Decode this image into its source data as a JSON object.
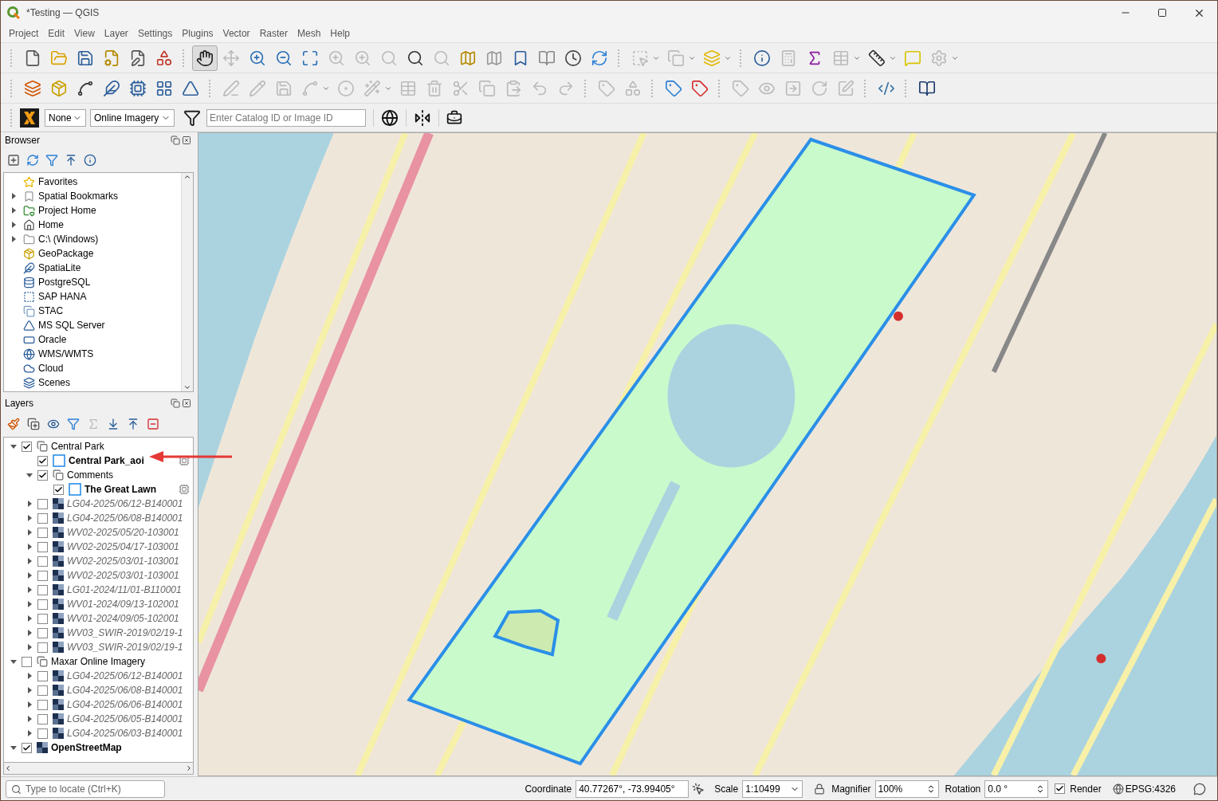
{
  "window": {
    "title": "*Testing — QGIS"
  },
  "menu": [
    "Project",
    "Edit",
    "View",
    "Layer",
    "Settings",
    "Plugins",
    "Vector",
    "Raster",
    "Mesh",
    "Help"
  ],
  "imagery_toolbar": {
    "dropdowns": [
      "None",
      "Online Imagery"
    ],
    "search": {
      "placeholder": "Enter Catalog ID or Image ID"
    }
  },
  "browser": {
    "title": "Browser",
    "items": [
      {
        "label": "Favorites"
      },
      {
        "label": "Spatial Bookmarks",
        "expanded": false
      },
      {
        "label": "Project Home",
        "expanded": false
      },
      {
        "label": "Home",
        "expanded": false
      },
      {
        "label": "C:\\ (Windows)",
        "expanded": false
      },
      {
        "label": "GeoPackage"
      },
      {
        "label": "SpatiaLite"
      },
      {
        "label": "PostgreSQL"
      },
      {
        "label": "SAP HANA"
      },
      {
        "label": "STAC"
      },
      {
        "label": "MS SQL Server"
      },
      {
        "label": "Oracle"
      },
      {
        "label": "WMS/WMTS"
      },
      {
        "label": "Cloud"
      },
      {
        "label": "Scenes"
      }
    ]
  },
  "layers": {
    "title": "Layers",
    "tree": [
      {
        "kind": "group",
        "label": "Central Park",
        "checked": true,
        "expanded": true,
        "children": [
          {
            "kind": "vector",
            "label": "Central Park_aoi",
            "checked": true
          },
          {
            "kind": "group",
            "label": "Comments",
            "checked": true,
            "expanded": true,
            "children": [
              {
                "kind": "vector",
                "label": "The Great Lawn",
                "checked": true
              }
            ]
          },
          {
            "kind": "raster",
            "label": "LG04-2025/06/12-B140001",
            "checked": false,
            "expanded": false
          },
          {
            "kind": "raster",
            "label": "LG04-2025/06/08-B140001",
            "checked": false,
            "expanded": false
          },
          {
            "kind": "raster",
            "label": "WV02-2025/05/20-103001",
            "checked": false,
            "expanded": false
          },
          {
            "kind": "raster",
            "label": "WV02-2025/04/17-103001",
            "checked": false,
            "expanded": false
          },
          {
            "kind": "raster",
            "label": "WV02-2025/03/01-103001",
            "checked": false,
            "expanded": false
          },
          {
            "kind": "raster",
            "label": "WV02-2025/03/01-103001",
            "checked": false,
            "expanded": false
          },
          {
            "kind": "raster",
            "label": "LG01-2024/11/01-B110001",
            "checked": false,
            "expanded": false
          },
          {
            "kind": "raster",
            "label": "WV01-2024/09/13-102001",
            "checked": false,
            "expanded": false
          },
          {
            "kind": "raster",
            "label": "WV01-2024/09/05-102001",
            "checked": false,
            "expanded": false
          },
          {
            "kind": "raster",
            "label": "WV03_SWIR-2019/02/19-1",
            "checked": false,
            "expanded": false
          },
          {
            "kind": "raster",
            "label": "WV03_SWIR-2019/02/19-1",
            "checked": false,
            "expanded": false
          }
        ]
      },
      {
        "kind": "group",
        "label": "Maxar Online Imagery",
        "checked": false,
        "expanded": true,
        "children": [
          {
            "kind": "raster",
            "label": "LG04-2025/06/12-B140001",
            "checked": false,
            "expanded": false
          },
          {
            "kind": "raster",
            "label": "LG04-2025/06/08-B140001",
            "checked": false,
            "expanded": false
          },
          {
            "kind": "raster",
            "label": "LG04-2025/06/06-B140001",
            "checked": false,
            "expanded": false
          },
          {
            "kind": "raster",
            "label": "LG04-2025/06/05-B140001",
            "checked": false,
            "expanded": false
          },
          {
            "kind": "raster",
            "label": "LG04-2025/06/03-B140001",
            "checked": false,
            "expanded": false
          }
        ]
      },
      {
        "kind": "basemap",
        "label": "OpenStreetMap",
        "checked": true,
        "expanded": true
      }
    ]
  },
  "locator": {
    "placeholder": "Type to locate (Ctrl+K)"
  },
  "status_bar": {
    "coordinate_label": "Coordinate",
    "coordinate": "40.77267°, -73.99405°",
    "scale_label": "Scale",
    "scale": "1:10499",
    "magnifier_label": "Magnifier",
    "magnifier": "100%",
    "rotation_label": "Rotation",
    "rotation": "0.0 °",
    "render": {
      "label": "Render",
      "checked": true
    },
    "crs": "EPSG:4326"
  }
}
